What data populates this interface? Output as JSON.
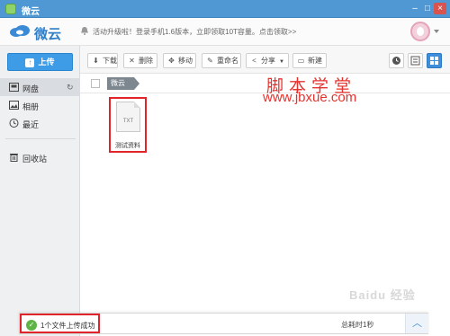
{
  "window": {
    "title": "微云",
    "controls": {
      "minimize": "–",
      "maximize": "□",
      "close": "×"
    }
  },
  "header": {
    "logo_text": "微云",
    "notice": "活动升级啦！登录手机1.6版本，立即领取10T容量。点击领取>>",
    "icons": {
      "logo": "cloud-logo-icon",
      "notice": "bell-icon",
      "avatar": "user-avatar"
    }
  },
  "sidebar": {
    "upload_label": "上传",
    "items": [
      {
        "label": "网盘",
        "icon": "disk-icon",
        "active": true
      },
      {
        "label": "相册",
        "icon": "photo-icon",
        "active": false
      },
      {
        "label": "最近",
        "icon": "clock-icon",
        "active": false
      },
      {
        "label": "回收站",
        "icon": "trash-icon",
        "active": false
      }
    ]
  },
  "toolbar": {
    "buttons": [
      {
        "label": "下载",
        "icon": "download-icon"
      },
      {
        "label": "删除",
        "icon": "delete-icon"
      },
      {
        "label": "移动",
        "icon": "move-icon"
      },
      {
        "label": "重命名",
        "icon": "rename-icon"
      },
      {
        "label": "分享",
        "icon": "share-icon"
      },
      {
        "label": "新建",
        "icon": "new-folder-icon"
      }
    ],
    "views": [
      "clock-view-icon",
      "list-view-icon",
      "grid-view-icon"
    ],
    "selected_view": "grid-view-icon"
  },
  "breadcrumb": {
    "root": "微云"
  },
  "watermark": {
    "cn": "脚本学堂",
    "url": "www.jbxue.com",
    "baidu": "Baidu 经验"
  },
  "files": [
    {
      "ext": "TXT",
      "name": "测试资料"
    }
  ],
  "status": {
    "message": "1个文件上传成功",
    "right_text": "总耗时1秒"
  },
  "colors": {
    "titlebar": "#4f98d4",
    "accent": "#3e9be6",
    "highlight": "#e0242a",
    "success": "#5bb445"
  }
}
